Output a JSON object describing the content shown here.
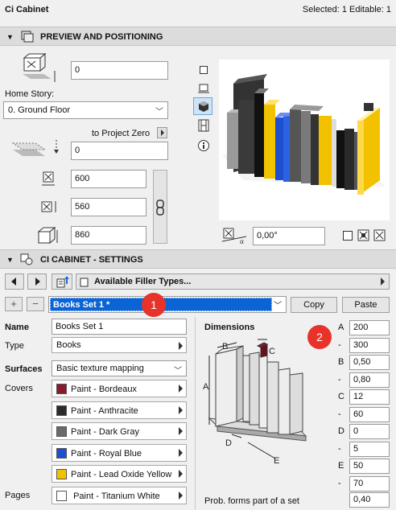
{
  "titlebar": {
    "title": "Ci Cabinet",
    "status": "Selected: 1 Editable: 1"
  },
  "preview_section": {
    "title": "PREVIEW AND POSITIONING"
  },
  "positioning": {
    "elevation_value": "0",
    "home_story_label": "Home Story:",
    "home_story_value": "0. Ground Floor",
    "project_zero_label": "to Project Zero",
    "project_zero_value": "0",
    "width_value": "600",
    "depth_value": "560",
    "height_value": "860",
    "angle_value": "0,00°"
  },
  "settings_section": {
    "title": "CI CABINET - SETTINGS"
  },
  "toolbar": {
    "available_label": "Available Filler Types...",
    "selected_set": "Books Set 1 *",
    "copy_label": "Copy",
    "paste_label": "Paste"
  },
  "callouts": {
    "one": "1",
    "two": "2"
  },
  "properties": {
    "name_label": "Name",
    "name_value": "Books Set 1",
    "type_label": "Type",
    "type_value": "Books",
    "surfaces_label": "Surfaces",
    "surfaces_value": "Basic texture mapping",
    "covers_label": "Covers",
    "pages_label": "Pages",
    "covers": [
      {
        "label": "Paint - Bordeaux",
        "color": "#8b1a2b"
      },
      {
        "label": "Paint - Anthracite",
        "color": "#2b2b2b"
      },
      {
        "label": "Paint - Dark Gray",
        "color": "#6a6a6a"
      },
      {
        "label": "Paint - Royal Blue",
        "color": "#1f4fd1"
      },
      {
        "label": "Paint - Lead Oxide Yellow",
        "color": "#f2c200"
      }
    ],
    "pages": {
      "label": "Paint - Titanium White",
      "color": "#ffffff"
    }
  },
  "dimensions": {
    "title": "Dimensions",
    "rows": [
      {
        "key": "A",
        "value": "200"
      },
      {
        "key": "-",
        "value": "300"
      },
      {
        "key": "B",
        "value": "0,50"
      },
      {
        "key": "-",
        "value": "0,80"
      },
      {
        "key": "C",
        "value": "12"
      },
      {
        "key": "-",
        "value": "60"
      },
      {
        "key": "D",
        "value": "0"
      },
      {
        "key": "-",
        "value": "5"
      },
      {
        "key": "E",
        "value": "50"
      },
      {
        "key": "-",
        "value": "70"
      }
    ],
    "prob_label": "Prob. forms part of a set",
    "prob_value": "0,40",
    "diagram_labels": {
      "a": "A",
      "b": "B",
      "c": "C",
      "d": "D",
      "e": "E"
    }
  }
}
